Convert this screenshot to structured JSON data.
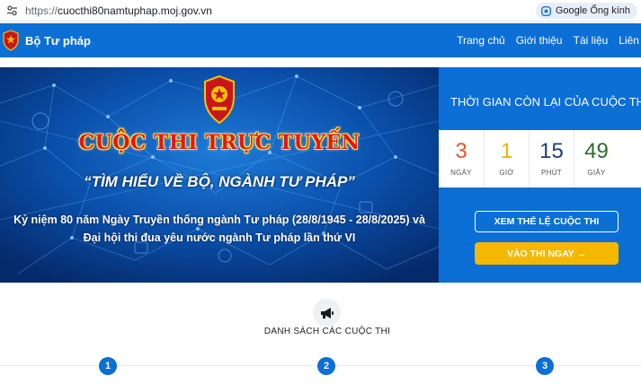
{
  "browser": {
    "url_scheme": "https://",
    "url_host": "cuocthi80namtuphap.moj.gov.vn",
    "lens_label": "Google Ống kính"
  },
  "header": {
    "brand": "Bộ Tư pháp",
    "nav": [
      "Trang chủ",
      "Giới thiệu",
      "Tài liệu",
      "Liên h"
    ]
  },
  "banner": {
    "title": "CUỘC THI TRỰC TUYẾN",
    "subtitle": "“TÌM HIỂU VỀ BỘ, NGÀNH TƯ PHÁP”",
    "line1": "Kỷ niệm 80 năm Ngày Truyền thống ngành Tư pháp (28/8/1945 - 28/8/2025) và",
    "line2": "Đại hội thi đua yêu nước ngành Tư pháp lần thứ VI"
  },
  "countdown": {
    "title": "THỜI GIAN CÒN LẠI CỦA CUỘC THI",
    "items": [
      {
        "value": "3",
        "label": "NGÀY",
        "color": "#e8562a"
      },
      {
        "value": "1",
        "label": "GIỜ",
        "color": "#f0b400"
      },
      {
        "value": "15",
        "label": "PHÚT",
        "color": "#1d3f73"
      },
      {
        "value": "49",
        "label": "GIÂY",
        "color": "#2e6b2e"
      }
    ],
    "rules_button": "XEM THỂ LỆ CUỘC THI",
    "enter_button": "VÀO THI NGAY →"
  },
  "contests": {
    "title": "DANH SÁCH CÁC CUỘC THI",
    "steps": [
      "1",
      "2",
      "3"
    ]
  },
  "colors": {
    "primary": "#0b6fd6",
    "accent": "#f5b800"
  }
}
